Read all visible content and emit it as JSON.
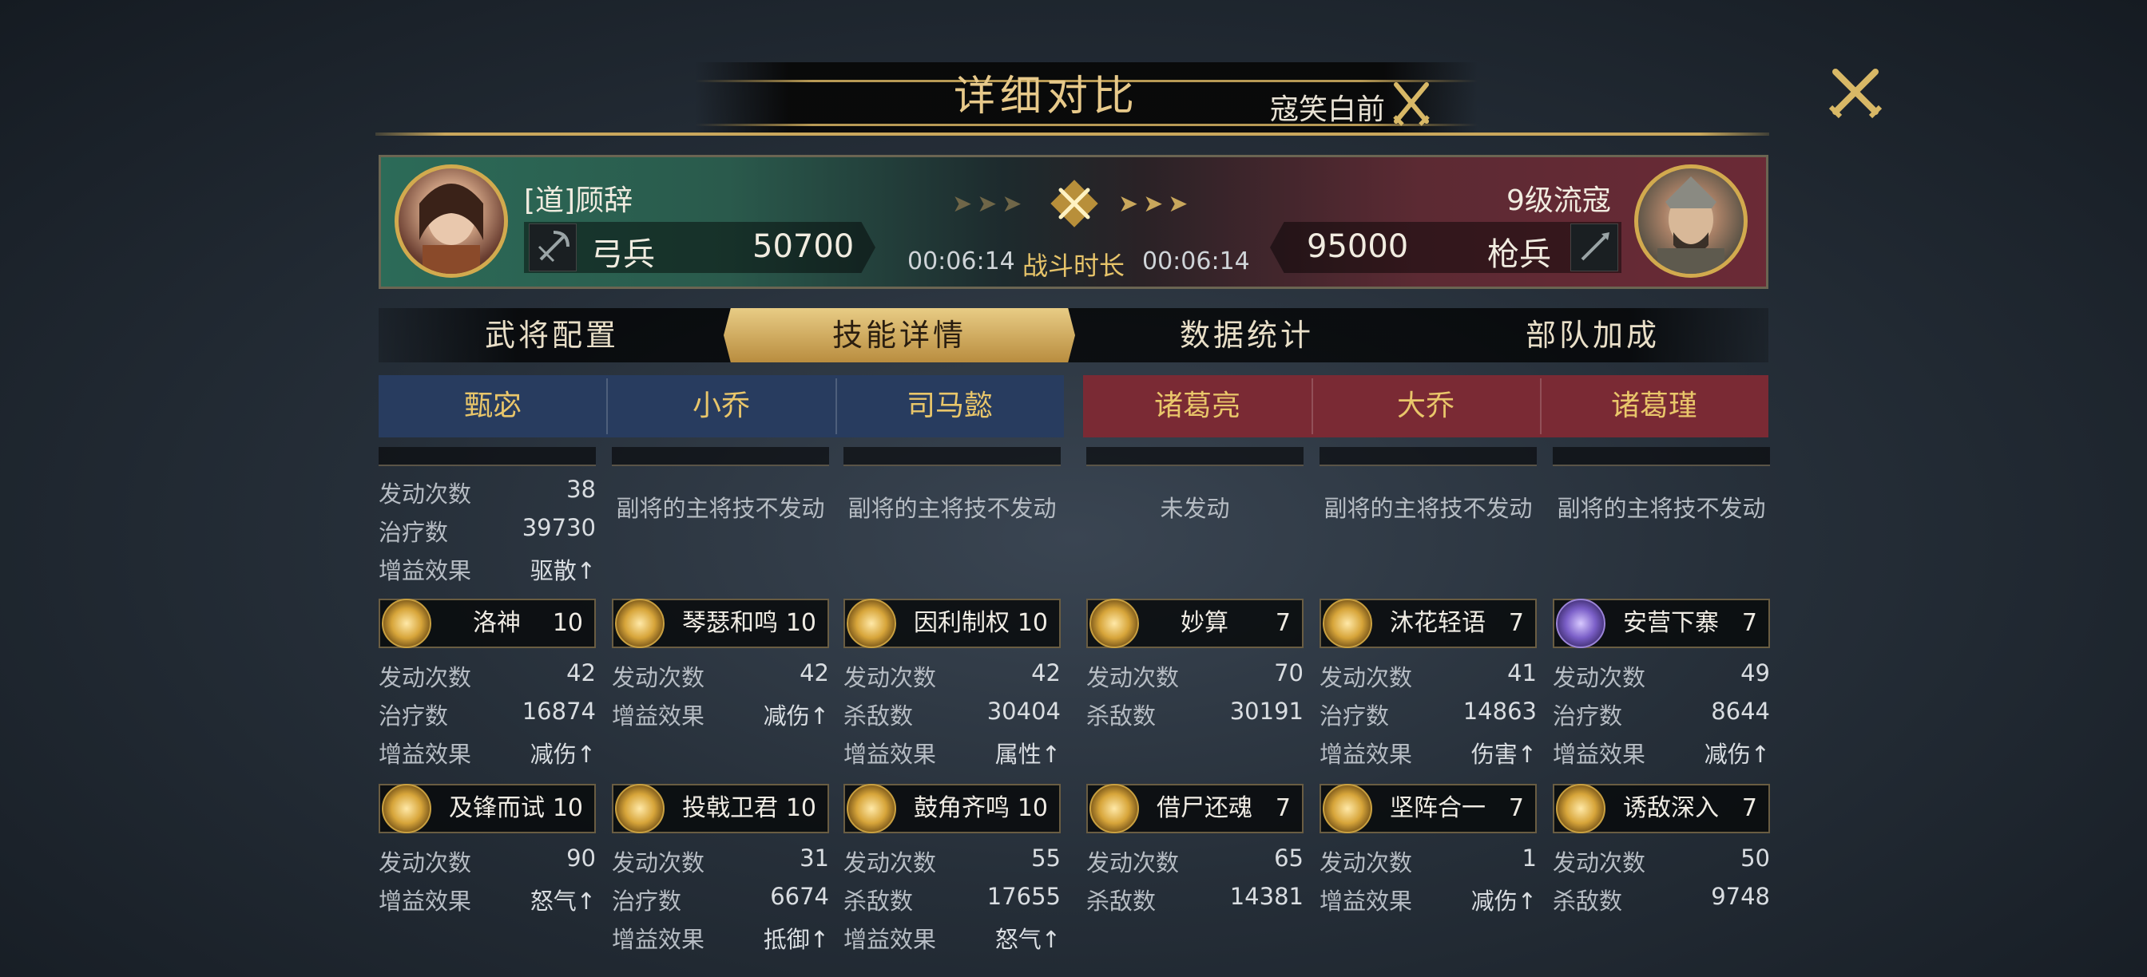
{
  "header": {
    "title": "详细对比",
    "subtitle": "寇笑白前"
  },
  "battle": {
    "left": {
      "name": "[道]顾辞",
      "troop": "弓兵",
      "troops": "50700",
      "time": "00:06:14"
    },
    "right": {
      "name": "9级流寇",
      "troop": "枪兵",
      "troops": "95000",
      "time": "00:06:14"
    },
    "duration_label": "战斗时长",
    "arrows_left": "➤➤➤",
    "arrows_right": "➤➤➤"
  },
  "tabs": [
    "武将配置",
    "技能详情",
    "数据统计",
    "部队加成"
  ],
  "heroes": [
    "甄宓",
    "小乔",
    "司马懿",
    "诸葛亮",
    "大乔",
    "诸葛瑾"
  ],
  "columns": [
    {
      "top": {
        "rows": [
          [
            "发动次数",
            "38"
          ],
          [
            "治疗数",
            "39730"
          ],
          [
            "增益效果",
            "驱散↑"
          ]
        ]
      },
      "skill1": {
        "name": "洛神",
        "level": "10",
        "rows": [
          [
            "发动次数",
            "42"
          ],
          [
            "治疗数",
            "16874"
          ],
          [
            "增益效果",
            "减伤↑"
          ]
        ]
      },
      "skill2": {
        "name": "及锋而试",
        "level": "10",
        "rows": [
          [
            "发动次数",
            "90"
          ],
          [
            "增益效果",
            "怒气↑"
          ]
        ]
      }
    },
    {
      "top": {
        "msg": "副将的主将技不发动"
      },
      "skill1": {
        "name": "琴瑟和鸣",
        "level": "10",
        "rows": [
          [
            "发动次数",
            "42"
          ],
          [
            "增益效果",
            "减伤↑"
          ]
        ]
      },
      "skill2": {
        "name": "投戟卫君",
        "level": "10",
        "rows": [
          [
            "发动次数",
            "31"
          ],
          [
            "治疗数",
            "6674"
          ],
          [
            "增益效果",
            "抵御↑"
          ]
        ]
      }
    },
    {
      "top": {
        "msg": "副将的主将技不发动"
      },
      "skill1": {
        "name": "因利制权",
        "level": "10",
        "rows": [
          [
            "发动次数",
            "42"
          ],
          [
            "杀敌数",
            "30404"
          ],
          [
            "增益效果",
            "属性↑"
          ]
        ]
      },
      "skill2": {
        "name": "鼓角齐鸣",
        "level": "10",
        "rows": [
          [
            "发动次数",
            "55"
          ],
          [
            "杀敌数",
            "17655"
          ],
          [
            "增益效果",
            "怒气↑"
          ]
        ]
      }
    },
    {
      "top": {
        "msg": "未发动"
      },
      "skill1": {
        "name": "妙算",
        "level": "7",
        "rows": [
          [
            "发动次数",
            "70"
          ],
          [
            "杀敌数",
            "30191"
          ]
        ]
      },
      "skill2": {
        "name": "借尸还魂",
        "level": "7",
        "rows": [
          [
            "发动次数",
            "65"
          ],
          [
            "杀敌数",
            "14381"
          ]
        ]
      }
    },
    {
      "top": {
        "msg": "副将的主将技不发动"
      },
      "skill1": {
        "name": "沐花轻语",
        "level": "7",
        "rows": [
          [
            "发动次数",
            "41"
          ],
          [
            "治疗数",
            "14863"
          ],
          [
            "增益效果",
            "伤害↑"
          ]
        ]
      },
      "skill2": {
        "name": "坚阵合一",
        "level": "7",
        "rows": [
          [
            "发动次数",
            "1"
          ],
          [
            "增益效果",
            "减伤↑"
          ]
        ]
      }
    },
    {
      "top": {
        "msg": "副将的主将技不发动"
      },
      "skill1": {
        "name": "安营下寨",
        "level": "7",
        "rows": [
          [
            "发动次数",
            "49"
          ],
          [
            "治疗数",
            "8644"
          ],
          [
            "增益效果",
            "减伤↑"
          ]
        ]
      },
      "skill2": {
        "name": "诱敌深入",
        "level": "7",
        "rows": [
          [
            "发动次数",
            "50"
          ],
          [
            "杀敌数",
            "9748"
          ]
        ]
      }
    }
  ],
  "colors": {
    "gold": "#c9a75c",
    "blue_team": "#283c5f",
    "red_team": "#7a2a34"
  }
}
